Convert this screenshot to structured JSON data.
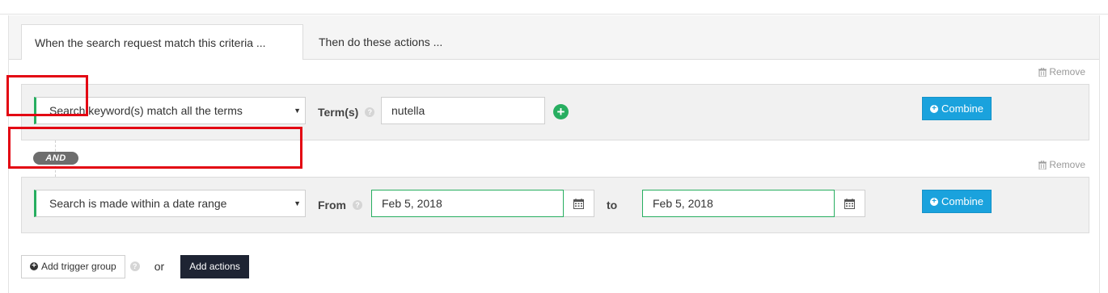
{
  "tabs": [
    {
      "label": "When the search request match this criteria ...",
      "active": true
    },
    {
      "label": "Then do these actions ...",
      "active": false
    }
  ],
  "remove_label": "Remove",
  "criteria": [
    {
      "type_select": "Search keyword(s) match all the terms",
      "field_label": "Term(s)",
      "term_value": "nutella",
      "combine_label": "Combine"
    },
    {
      "type_select": "Search is made within a date range",
      "from_label": "From",
      "from_value": "Feb 5, 2018",
      "to_label": "to",
      "to_value": "Feb 5, 2018",
      "combine_label": "Combine"
    }
  ],
  "connector": "AND",
  "footer": {
    "add_trigger_label": "Add trigger group",
    "or_text": "or",
    "add_actions_label": "Add actions"
  },
  "colors": {
    "accent_green": "#27ae60",
    "combine_blue": "#1aa2dd",
    "highlight_red": "#e30613",
    "dark_button": "#1e2433"
  }
}
